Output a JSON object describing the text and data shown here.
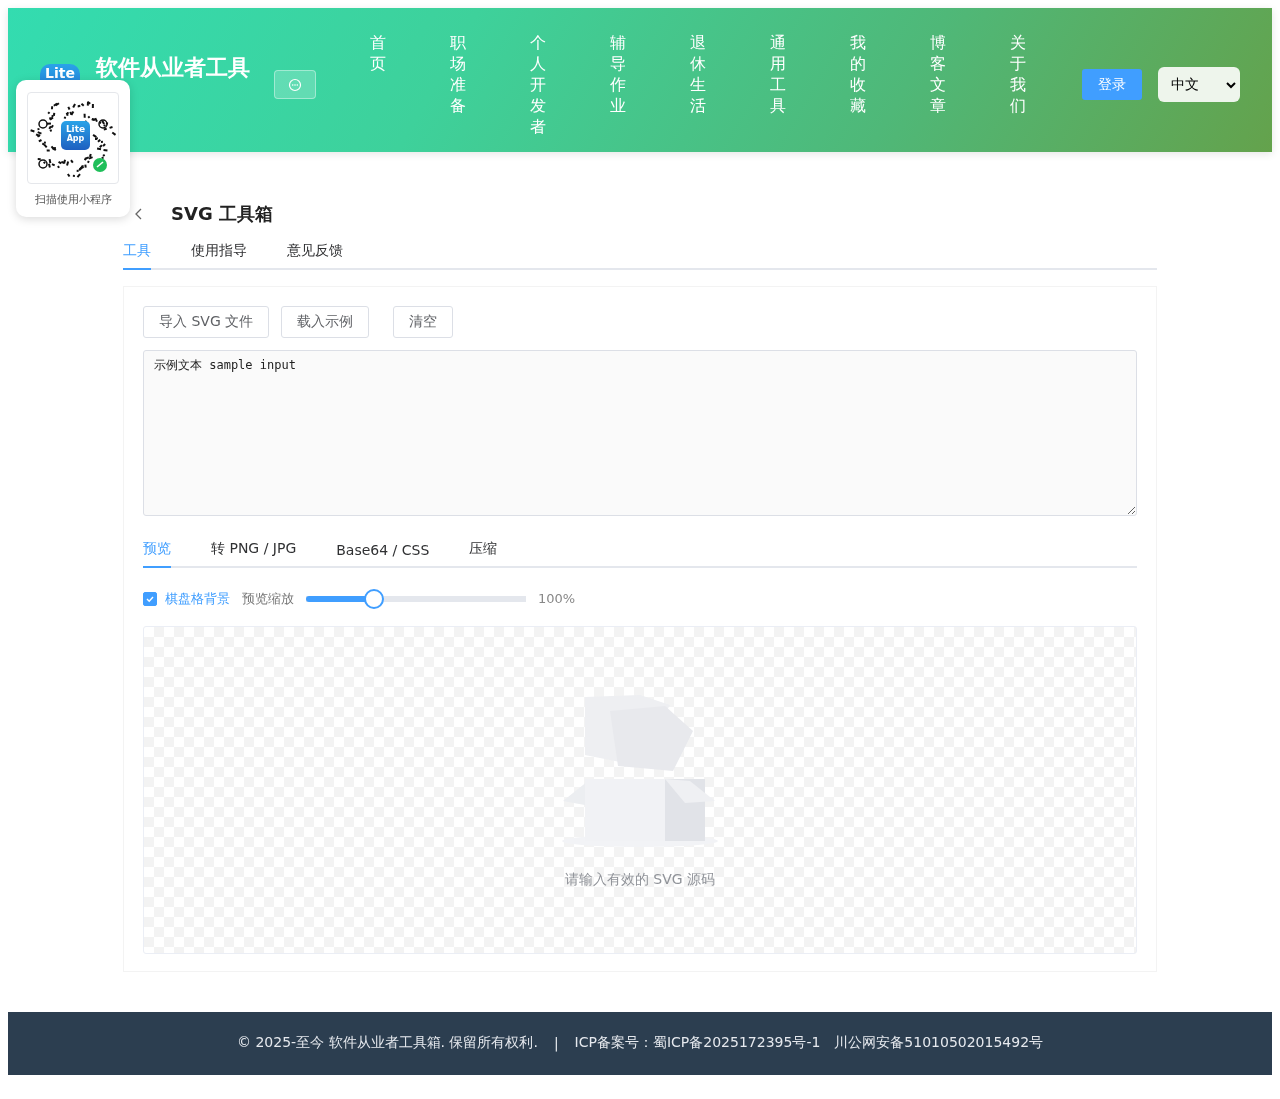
{
  "header": {
    "logo_text": "Lite",
    "site_title": "软件从业者工具",
    "nav": [
      {
        "label": "首页"
      },
      {
        "label": "职场准备"
      },
      {
        "label": "个人开发者"
      },
      {
        "label": "辅导作业"
      },
      {
        "label": "退休生活"
      },
      {
        "label": "通用工具"
      },
      {
        "label": "我的收藏"
      },
      {
        "label": "博客文章"
      },
      {
        "label": "关于我们"
      }
    ],
    "login": "登录",
    "language": "中文"
  },
  "qr_popup": {
    "logo_lines": [
      "Lite",
      "App"
    ],
    "caption": "扫描使用小程序"
  },
  "page": {
    "title": "SVG 工具箱",
    "tabs": [
      {
        "label": "工具",
        "selected": true
      },
      {
        "label": "使用指导",
        "selected": false
      },
      {
        "label": "意见反馈",
        "selected": false
      }
    ],
    "buttons": [
      "导入 SVG 文件",
      "载入示例",
      "清空"
    ],
    "editor": {
      "value": "示例文本 sample input"
    },
    "sub_tabs": [
      {
        "label": "预览",
        "selected": true
      },
      {
        "label": "转 PNG / JPG",
        "selected": false
      },
      {
        "label": "Base64 / CSS",
        "selected": false
      },
      {
        "label": "压缩",
        "selected": false
      }
    ],
    "checkerboard": {
      "label": "棋盘格背景",
      "checked": true
    },
    "zoom": {
      "label": "预览缩放",
      "level": 0.31,
      "reading": "100%"
    },
    "empty_text": "请输入有效的 SVG 源码"
  },
  "footer": {
    "copyright": "© 2025-至今 软件从业者工具箱. 保留所有权利.",
    "separator": "|",
    "icp": "ICP备案号：蜀ICP备2025172395号-1",
    "police": "川公网安备51010502015492号"
  }
}
